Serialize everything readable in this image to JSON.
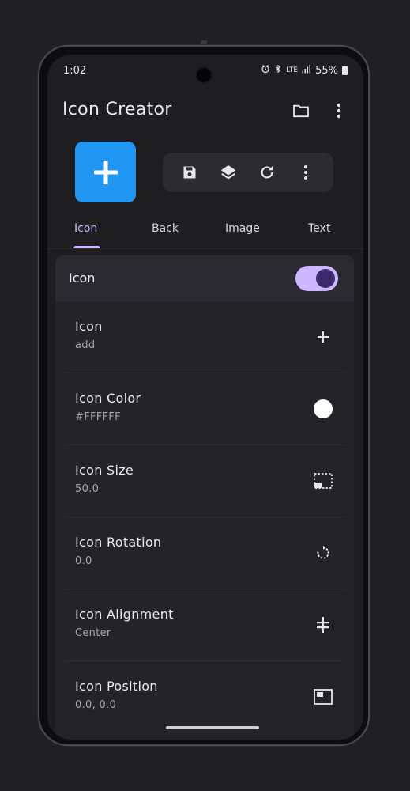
{
  "status": {
    "time": "1:02",
    "signal_text": "LTE",
    "battery": "55%"
  },
  "app": {
    "title": "Icon Creator"
  },
  "preview": {
    "icon": "add-icon",
    "background_color": "#2196F3"
  },
  "toolbar": {
    "items": [
      "save-icon",
      "layers-icon",
      "refresh-icon",
      "more-vert-icon"
    ]
  },
  "tabs": [
    {
      "label": "Icon",
      "active": true
    },
    {
      "label": "Back",
      "active": false
    },
    {
      "label": "Image",
      "active": false
    },
    {
      "label": "Text",
      "active": false
    }
  ],
  "icon_toggle": {
    "label": "Icon",
    "enabled": true
  },
  "settings": [
    {
      "title": "Icon",
      "value": "add",
      "icon": "add-icon"
    },
    {
      "title": "Icon Color",
      "value": "#FFFFFF",
      "icon": "color-swatch"
    },
    {
      "title": "Icon Size",
      "value": "50.0",
      "icon": "resize-icon"
    },
    {
      "title": "Icon Rotation",
      "value": "0.0",
      "icon": "rotate-icon"
    },
    {
      "title": "Icon Alignment",
      "value": "Center",
      "icon": "align-center-icon"
    },
    {
      "title": "Icon Position",
      "value": "0.0, 0.0",
      "icon": "position-icon"
    }
  ],
  "colors": {
    "accent": "#CDB8FF",
    "surface": "#242328",
    "background": "#1E1E21"
  }
}
